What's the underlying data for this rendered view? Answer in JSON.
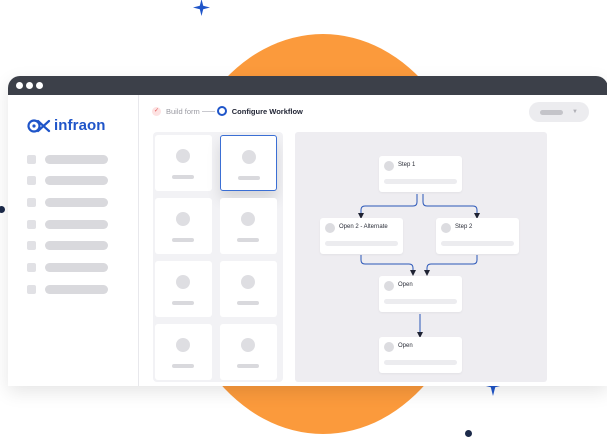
{
  "brand": {
    "name": "infraon",
    "color": "#1f55c9"
  },
  "decor": {
    "circle_color": "#fb9a3c",
    "star_color": "#1f55c9",
    "dot_color": "#1c2a4a"
  },
  "window": {
    "controls": [
      "window-dot",
      "window-dot",
      "window-dot"
    ]
  },
  "sidebar": {
    "item_count": 7
  },
  "stepper": {
    "steps": [
      {
        "label": "Build form",
        "status": "completed",
        "icon": "check-icon"
      },
      {
        "label": "Configure Workflow",
        "status": "active",
        "icon": "ring-icon"
      }
    ]
  },
  "dropdown": {
    "icon": "chevron-down-icon"
  },
  "palette": {
    "card_count": 8,
    "selected_index": 1
  },
  "workflow": {
    "nodes": [
      {
        "id": "step1",
        "label": "Step 1"
      },
      {
        "id": "open2alt",
        "label": "Open 2 - Alternate"
      },
      {
        "id": "step2",
        "label": "Step 2"
      },
      {
        "id": "open_a",
        "label": "Open"
      },
      {
        "id": "open_b",
        "label": "Open"
      }
    ],
    "connections": [
      [
        "step1",
        "open2alt"
      ],
      [
        "step1",
        "step2"
      ],
      [
        "open2alt",
        "open_a"
      ],
      [
        "step2",
        "open_a"
      ],
      [
        "open_a",
        "open_b"
      ]
    ],
    "connector_color": "#2b57b8"
  }
}
